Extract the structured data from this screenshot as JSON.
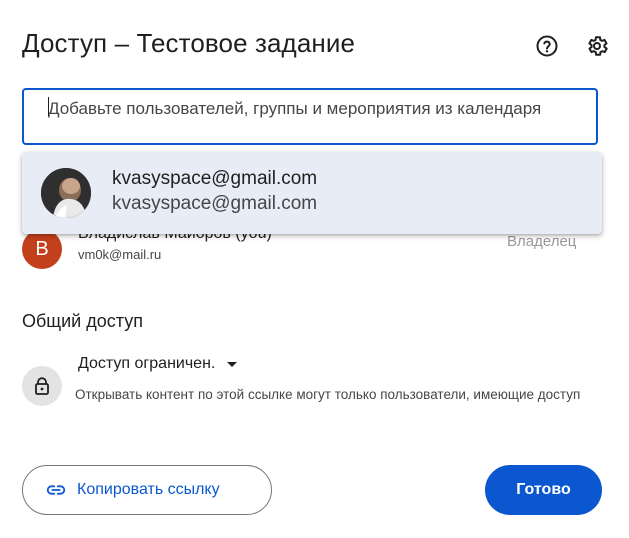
{
  "dialog": {
    "title": "Доступ – Тестовое задание",
    "help_icon": "help-circle-icon",
    "settings_icon": "gear-icon"
  },
  "add_people": {
    "placeholder": "Добавьте пользователей, группы и мероприятия из календаря",
    "value": "",
    "accent_color": "#0b57d0"
  },
  "suggestion": {
    "name": "kvasyspace@gmail.com",
    "email": "kvasyspace@gmail.com",
    "background": "#e8ecf6"
  },
  "owner": {
    "avatar_letter": "В",
    "name": "Владислав Майоров (you)",
    "email": "vm0k@mail.ru",
    "role": "Владелец",
    "avatar_color": "#c3401c"
  },
  "general_access": {
    "title": "Общий доступ",
    "selected_option": "Доступ ограничен.",
    "description": "Открывать контент по этой ссылке могут только пользователи, имеющие доступ",
    "icon": "lock-icon"
  },
  "footer": {
    "copy_link_label": "Копировать ссылку",
    "copy_link_icon": "link-icon",
    "done_label": "Готово",
    "done_color": "#0b57d0"
  }
}
